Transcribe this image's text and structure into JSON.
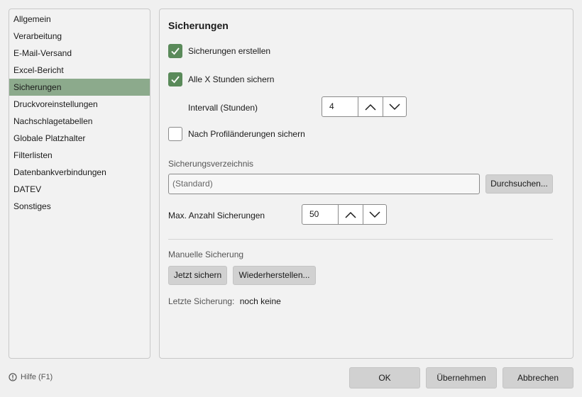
{
  "sidebar": {
    "items": [
      {
        "label": "Allgemein"
      },
      {
        "label": "Verarbeitung"
      },
      {
        "label": "E-Mail-Versand"
      },
      {
        "label": "Excel-Bericht"
      },
      {
        "label": "Sicherungen",
        "selected": true
      },
      {
        "label": "Druckvoreinstellungen"
      },
      {
        "label": "Nachschlagetabellen"
      },
      {
        "label": "Globale Platzhalter"
      },
      {
        "label": "Filterlisten"
      },
      {
        "label": "Datenbankverbindungen"
      },
      {
        "label": "DATEV"
      },
      {
        "label": "Sonstiges"
      }
    ]
  },
  "main": {
    "title": "Sicherungen",
    "create_backups": {
      "label": "Sicherungen erstellen",
      "checked": true
    },
    "every_x_hours": {
      "label": "Alle X Stunden sichern",
      "checked": true
    },
    "interval": {
      "label": "Intervall (Stunden)",
      "value": "4"
    },
    "after_profile_change": {
      "label": "Nach Profiländerungen sichern",
      "checked": false
    },
    "directory": {
      "heading": "Sicherungsverzeichnis",
      "placeholder": "(Standard)",
      "browse_label": "Durchsuchen..."
    },
    "max_backups": {
      "label": "Max. Anzahl Sicherungen",
      "value": "50"
    },
    "manual": {
      "heading": "Manuelle Sicherung",
      "backup_now_label": "Jetzt sichern",
      "restore_label": "Wiederherstellen...",
      "last_backup_label": "Letzte Sicherung:",
      "last_backup_value": "noch keine"
    }
  },
  "footer": {
    "help_label": "Hilfe (F1)",
    "ok_label": "OK",
    "apply_label": "Übernehmen",
    "cancel_label": "Abbrechen"
  },
  "colors": {
    "accent": "#5a8a5a",
    "selection": "#8caa8c"
  },
  "icons": [
    "checkmark-icon",
    "chevron-up-icon",
    "chevron-down-icon",
    "info-icon"
  ]
}
